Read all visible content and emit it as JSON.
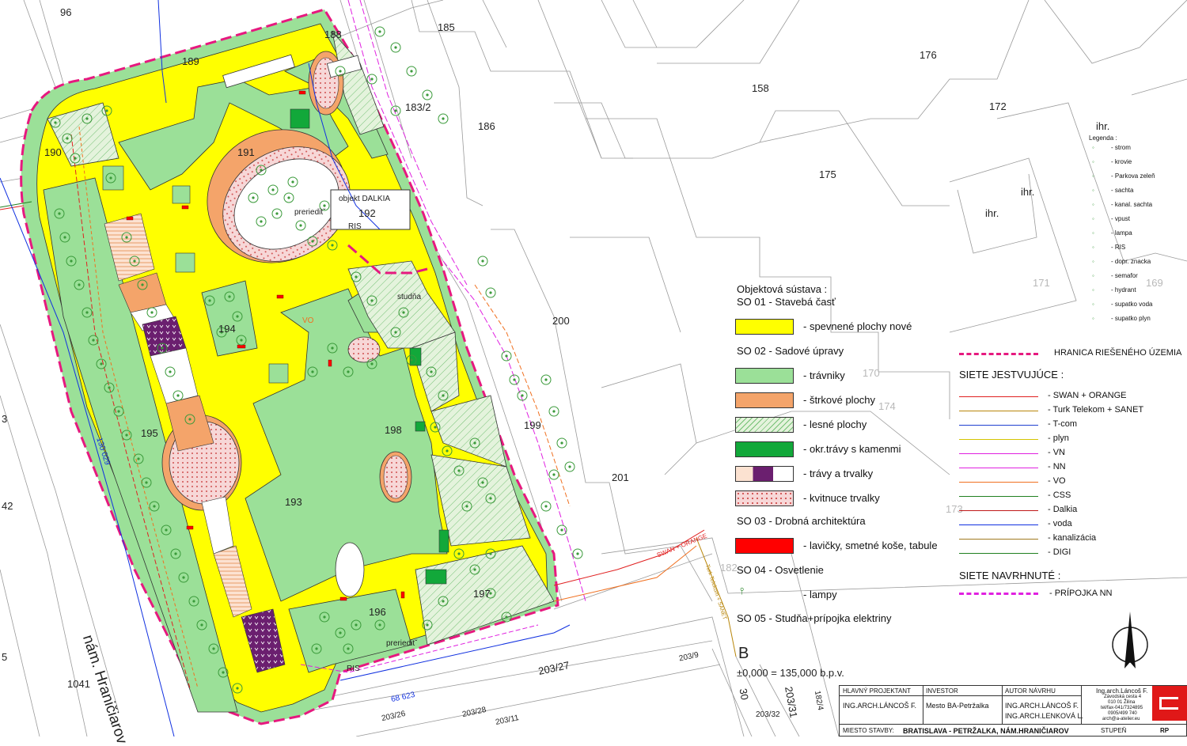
{
  "colors": {
    "paved": "#ffff00",
    "lawn": "#9be098",
    "gravel": "#f4a46a",
    "forest": "#d7efcf",
    "stone_grass": "#12a83a",
    "bench": "#ff0000",
    "boundary": "#e6197f",
    "perennial": "#f7d7d7"
  },
  "parcels": {
    "p96": "96",
    "p189": "189",
    "p188": "188",
    "p185": "185",
    "p183_2": "183/2",
    "p186": "186",
    "p176": "176",
    "p158": "158",
    "p172": "172",
    "p175": "175",
    "p190": "190",
    "p191": "191",
    "p192": "192",
    "p194": "194",
    "p195": "195",
    "p198": "198",
    "p193": "193",
    "p196": "196",
    "p197": "197",
    "p199": "199",
    "p200": "200",
    "p201": "201",
    "p1041": "1041",
    "p203_27": "203/27",
    "p203_26": "203/26",
    "p203_28": "203/28",
    "p203_11": "203/11",
    "p203_9": "203/9",
    "p171": "171",
    "p169": "169",
    "p174": "174",
    "p173": "173",
    "p170": "170",
    "ihr1": "ihr.",
    "ihr2": "ihr.",
    "ihr3": "ihr.",
    "edge3": "3",
    "edge42": "42",
    "edge5": "5",
    "p182": "182",
    "p30": "30",
    "p203_31": "203/31",
    "p182_4": "182/4",
    "p203_32": "203/32"
  },
  "annotations": {
    "objekt_dalkia": "objekt DALKIA",
    "ris1": "RIS",
    "ris2": "RIS",
    "prerieditv1": "prerieditˇ",
    "prerieditv2": "prerieditˇ",
    "studna": "studňa",
    "square_name": "nám. Hraničiarov",
    "dim1": "130 029",
    "dim2": "68 623",
    "vo": "VO",
    "swan_orange": "SWAN + ORANGE",
    "turk_label": "Turk Telekom + SANET",
    "section_b": "B",
    "elevation": "±0,000 = 135,000 b.p.v."
  },
  "legend": {
    "header1": "Objektová sústava :",
    "so01": "SO 01 - Stavebá časť",
    "paved": "- spevnené plochy nové",
    "so02": "SO 02 - Sadové úpravy",
    "lawns": "- trávniky",
    "gravel": "- štrkové plochy",
    "forest": "- lesné plochy",
    "stone_grass": "- okr.trávy s kamenmi",
    "perennials": "- trávy a trvalky",
    "flowering": "- kvitnuce trvalky",
    "so03": "SO 03 - Drobná architektúra",
    "benches": "- lavičky, smetné koše, tabule",
    "so04": "SO 04 - Osvetlenie",
    "lamps": "- lampy",
    "so05": "SO 05 - Studňa+prípojka elektriny"
  },
  "networks": {
    "boundary": "HRANICA RIEŠENÉHO ÚZEMIA",
    "existing_header": "SIETE JESTVUJÚCE :",
    "items": [
      {
        "label": "- SWAN + ORANGE",
        "color": "#e02020"
      },
      {
        "label": "- Turk Telekom + SANET",
        "color": "#b8860b"
      },
      {
        "label": "- T-com",
        "color": "#2040d0"
      },
      {
        "label": "- plyn",
        "color": "#d4c400"
      },
      {
        "label": "- VN",
        "color": "#e020e0"
      },
      {
        "label": "- NN",
        "color": "#e020e0"
      },
      {
        "label": "- VO",
        "color": "#f07020"
      },
      {
        "label": "- CSS",
        "color": "#208020"
      },
      {
        "label": "- Dalkia",
        "color": "#c01818"
      },
      {
        "label": "- voda",
        "color": "#1030e0"
      },
      {
        "label": "- kanalizácia",
        "color": "#a07a20"
      },
      {
        "label": "- DIGI",
        "color": "#208020"
      }
    ],
    "proposed_header": "SIETE NAVRHNUTÉ :",
    "proposed_item": "- PRÍPOJKA NN"
  },
  "symbols": {
    "title": "Legenda :",
    "items": [
      "- strom",
      "- krovie",
      "- Parkova zeleň",
      "- sachta",
      "- kanal. sachta",
      "- vpust",
      "- lampa",
      "- RIS",
      "- dopr. znacka",
      "- semafor",
      "- hydrant",
      "- supatko voda",
      "- supatko plyn"
    ]
  },
  "title_block": {
    "c1_head": "HLAVNÝ PROJEKTANT",
    "c1_val": "ING.ARCH.LÁNCOŠ F.",
    "c2_head": "INVESTOR",
    "c2_val": "Mesto BA-Petržalka",
    "c3_head": "AUTOR NÁVRHU",
    "c3_val1": "ING.ARCH.LÁNCOŠ F.",
    "c3_val2": "ING.ARCH.LENKOVÁ L.",
    "firm1": "Ing.arch.Láncoš F.",
    "firm2": "Závodská cesta 4",
    "firm3": "010 01 Žilina",
    "firm4": "tel/fax-041/7324895",
    "firm5": "0905/499 740",
    "firm6": "arch@a-atelier.eu",
    "place_head": "MIESTO STAVBY:",
    "place_val": "BRATISLAVA - PETRŽALKA, NÁM.HRANIČIAROV",
    "stage_head": "STUPEŇ",
    "stage_val": "RP"
  },
  "icons": {
    "north": "north-arrow-icon",
    "logo": "firm-logo-icon",
    "tree": "tree-icon"
  }
}
